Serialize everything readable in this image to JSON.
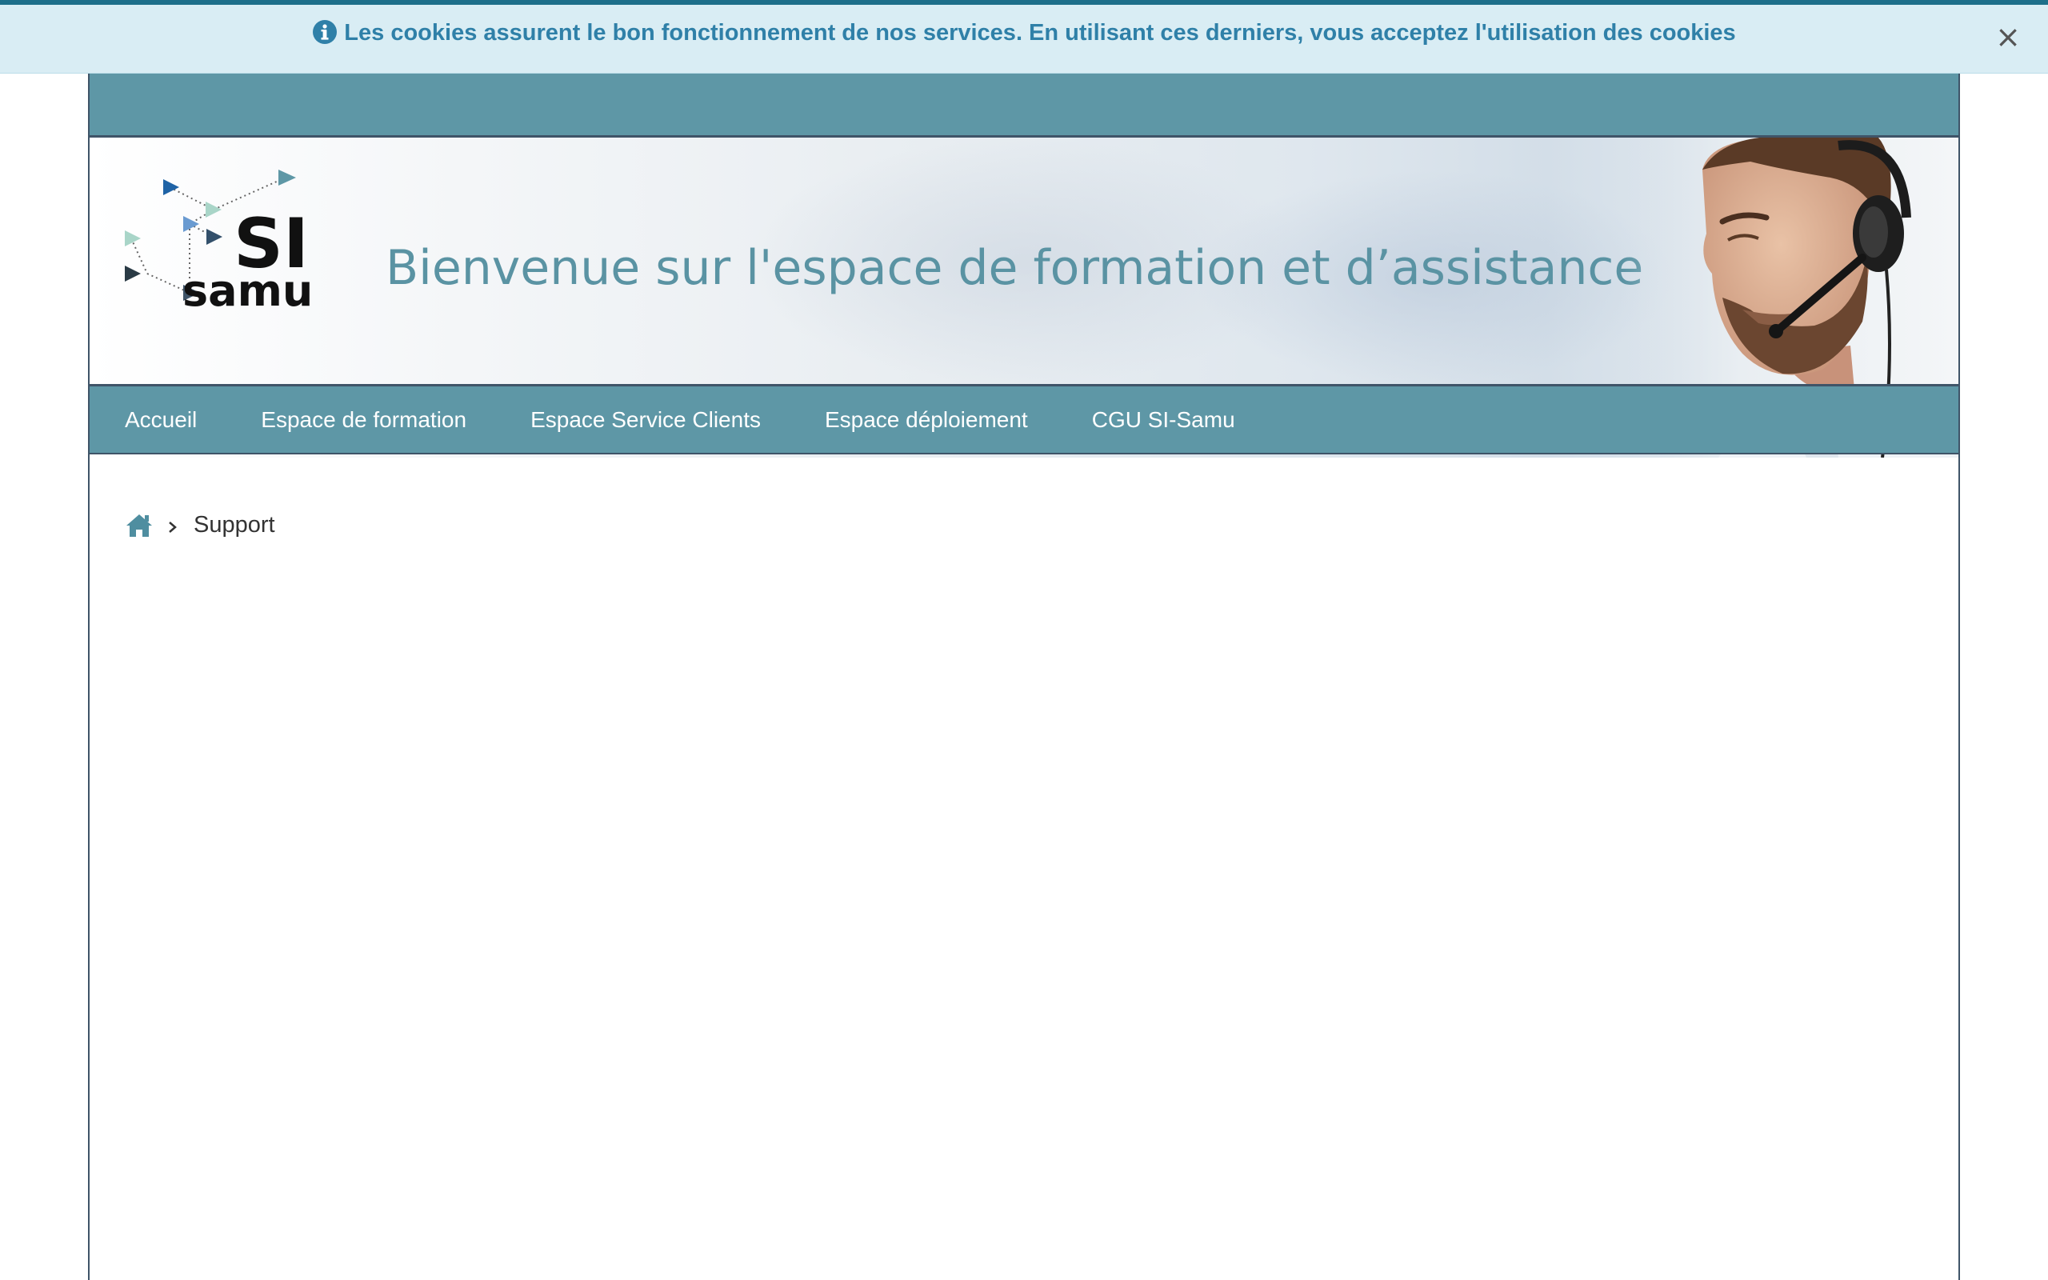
{
  "cookie_banner": {
    "message": "Les cookies assurent le bon fonctionnement de nos services. En utilisant ces derniers, vous acceptez l'utilisation des cookies",
    "close_label": "×",
    "icon": "info-icon"
  },
  "header": {
    "logo_text_top": "SI",
    "logo_text_bottom": "samu",
    "title": "Bienvenue sur l'espace de formation et d’assistance"
  },
  "nav": {
    "items": [
      {
        "label": "Accueil"
      },
      {
        "label": "Espace de formation"
      },
      {
        "label": "Espace Service Clients"
      },
      {
        "label": "Espace déploiement"
      },
      {
        "label": "CGU SI-Samu"
      }
    ]
  },
  "breadcrumb": {
    "home_icon": "home-icon",
    "separator_icon": "chevron-right-icon",
    "current": "Support"
  },
  "colors": {
    "primary": "#5e97a6",
    "border": "#3f5468",
    "cookie_bg": "#d9edf4",
    "cookie_text": "#2f80a8"
  }
}
